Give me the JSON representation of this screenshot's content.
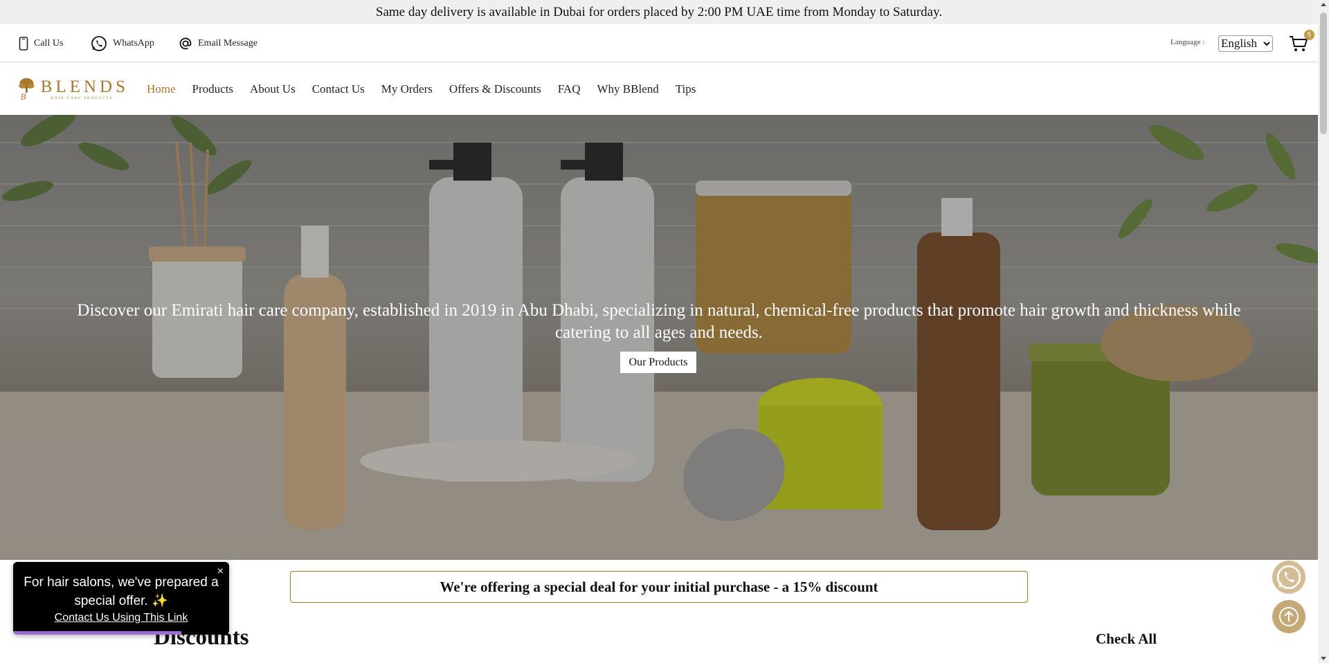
{
  "announcement": "Same day delivery is available in Dubai for orders placed by 2:00 PM UAE time from Monday to Saturday.",
  "contact_bar": {
    "call": {
      "label": "Call Us",
      "icon": "phone-icon"
    },
    "whatsapp": {
      "label": "WhatsApp",
      "icon": "whatsapp-icon"
    },
    "email": {
      "label": "Email Message",
      "icon": "at-sign-icon"
    },
    "language_label": "Language :",
    "language_value": "English",
    "cart_count": "5"
  },
  "brand": {
    "name": "BLENDS",
    "tagline": "HAIR CARE PRODUCTS",
    "color": "#a8772c"
  },
  "nav": {
    "items": [
      {
        "label": "Home",
        "active": true
      },
      {
        "label": "Products",
        "active": false
      },
      {
        "label": "About Us",
        "active": false
      },
      {
        "label": "Contact Us",
        "active": false
      },
      {
        "label": "My Orders",
        "active": false
      },
      {
        "label": "Offers & Discounts",
        "active": false
      },
      {
        "label": "FAQ",
        "active": false
      },
      {
        "label": "Why BBlend",
        "active": false
      },
      {
        "label": "Tips",
        "active": false
      }
    ]
  },
  "hero": {
    "text": "Discover our Emirati hair care company, established in 2019 in Abu Dhabi, specializing in natural, chemical-free products that promote hair growth and thickness while catering to all ages and needs.",
    "button": "Our Products"
  },
  "offer_banner": "We're offering a special deal for your initial purchase - a 15% discount",
  "discounts": {
    "title": "Discounts",
    "check_all": "Check All"
  },
  "popup": {
    "text": "For hair salons, we've prepared a special offer. ✨",
    "link": "Contact Us Using This Link",
    "close": "×",
    "progress": 0.78
  },
  "floating": {
    "whatsapp_icon": "whatsapp-icon",
    "top_icon": "arrow-up-icon"
  }
}
